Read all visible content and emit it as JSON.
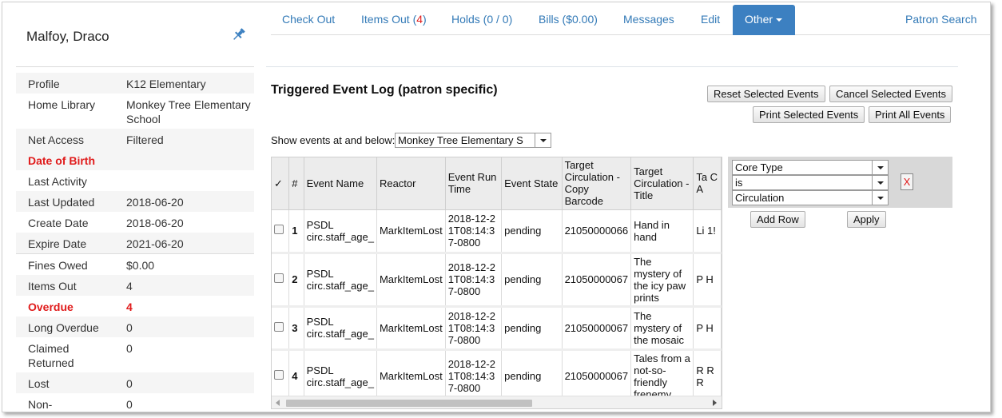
{
  "patron": {
    "name": "Malfoy, Draco",
    "summary": [
      {
        "label": "Profile",
        "value": "K12 Elementary"
      },
      {
        "label": "Home Library",
        "value": "Monkey Tree Elementary School"
      },
      {
        "label": "Net Access",
        "value": "Filtered"
      },
      {
        "label": "Date of Birth",
        "value": ""
      },
      {
        "label": "Last Activity",
        "value": ""
      },
      {
        "label": "Last Updated",
        "value": "2018-06-20"
      },
      {
        "label": "Create Date",
        "value": "2018-06-20"
      },
      {
        "label": "Expire Date",
        "value": "2021-06-20"
      },
      {
        "label": "Fines Owed",
        "value": "$0.00"
      },
      {
        "label": "Items Out",
        "value": "4"
      },
      {
        "label": "Overdue",
        "value": "4"
      },
      {
        "label": "Long Overdue",
        "value": "0"
      },
      {
        "label": "Claimed Returned",
        "value": "0"
      },
      {
        "label": "Lost",
        "value": "0"
      },
      {
        "label": "Non-",
        "value": "0"
      }
    ]
  },
  "nav": {
    "check_out": "Check Out",
    "items_out": "Items Out (",
    "items_out_count": "4",
    "items_out_close": ")",
    "holds": "Holds (0 / 0)",
    "bills": "Bills ($0.00)",
    "messages": "Messages",
    "edit": "Edit",
    "other": "Other",
    "patron_search": "Patron Search"
  },
  "page": {
    "title": "Triggered Event Log (patron specific)",
    "show_events_label": "Show events at and below:",
    "org_unit_value": "Monkey Tree Elementary S",
    "buttons": {
      "reset_selected": "Reset Selected Events",
      "cancel_selected": "Cancel Selected Events",
      "print_selected": "Print Selected Events",
      "print_all": "Print All Events"
    }
  },
  "grid": {
    "columns": [
      "✓",
      "#",
      "Event Name",
      "Reactor",
      "Event Run Time",
      "Event State",
      "Target Circulation - Copy Barcode",
      "Target Circulation - Title",
      "Ta C A"
    ],
    "rows": [
      {
        "num": "1",
        "event_name": "PSDL circ.staff_age_",
        "reactor": "MarkItemLost",
        "run_time": "2018-12-21T08:14:37-0800",
        "state": "pending",
        "barcode": "21050000066",
        "title": "Hand in hand",
        "extra": "Li 1!"
      },
      {
        "num": "2",
        "event_name": "PSDL circ.staff_age_",
        "reactor": "MarkItemLost",
        "run_time": "2018-12-21T08:14:37-0800",
        "state": "pending",
        "barcode": "21050000067",
        "title": "The mystery of the icy paw prints",
        "extra": "P H"
      },
      {
        "num": "3",
        "event_name": "PSDL circ.staff_age_",
        "reactor": "MarkItemLost",
        "run_time": "2018-12-21T08:14:37-0800",
        "state": "pending",
        "barcode": "21050000067",
        "title": "The mystery of the mosaic",
        "extra": "P H"
      },
      {
        "num": "4",
        "event_name": "PSDL circ.staff_age_",
        "reactor": "MarkItemLost",
        "run_time": "2018-12-21T08:14:37-0800",
        "state": "pending",
        "barcode": "21050000067",
        "title": "Tales from a not-so-friendly frenemy",
        "extra": "R R R"
      }
    ]
  },
  "filter": {
    "field": "Core Type",
    "operator": "is",
    "value": "Circulation",
    "remove": "X",
    "add_row": "Add Row",
    "apply": "Apply"
  },
  "colors": {
    "accent": "#3c80c1",
    "link": "#337ab7",
    "alert": "#e01b1b"
  }
}
